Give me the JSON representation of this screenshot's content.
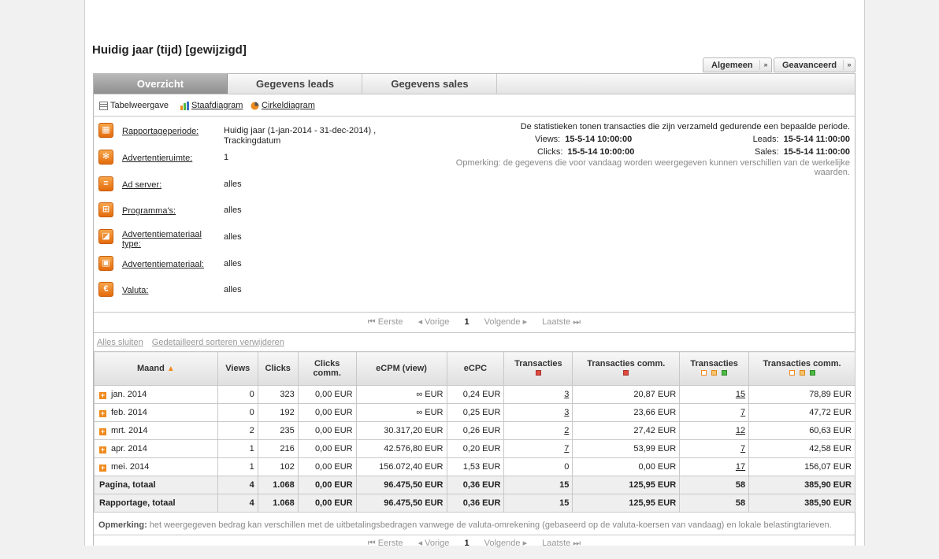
{
  "page": {
    "title": "Huidig jaar (tijd) [gewijzigd]"
  },
  "top_buttons": [
    {
      "label": "Algemeen"
    },
    {
      "label": "Geavanceerd"
    }
  ],
  "tabs": [
    {
      "label": "Overzicht"
    },
    {
      "label": "Gegevens leads"
    },
    {
      "label": "Gegevens sales"
    }
  ],
  "views": [
    {
      "label": "Tabelweergave",
      "icon": "table-icon"
    },
    {
      "label": "Staafdiagram",
      "icon": "bar-chart-icon"
    },
    {
      "label": "Cirkeldiagram",
      "icon": "pie-chart-icon"
    }
  ],
  "filters": [
    {
      "label": "Rapportageperiode:",
      "value": "Huidig jaar (1-jan-2014 - 31-dec-2014) , Trackingdatum",
      "icon": "calendar-icon"
    },
    {
      "label": "Advertentieruimte:",
      "value": "1",
      "icon": "network-icon"
    },
    {
      "label": "Ad server:",
      "value": "alles",
      "icon": "server-icon"
    },
    {
      "label": "Programma's:",
      "value": "alles",
      "icon": "grid-icon"
    },
    {
      "label": "Advertentiemateriaal type:",
      "value": "alles",
      "icon": "material-type-icon"
    },
    {
      "label": "Advertentiemateriaal:",
      "value": "alles",
      "icon": "image-icon"
    },
    {
      "label": "Valuta:",
      "value": "alles",
      "icon": "euro-icon"
    }
  ],
  "stats": {
    "note": "De statistieken tonen transacties die zijn verzameld gedurende een bepaalde periode.",
    "views_label": "Views:",
    "views_value": "15-5-14 10:00:00",
    "clicks_label": "Clicks:",
    "clicks_value": "15-5-14 10:00:00",
    "leads_label": "Leads:",
    "leads_value": "15-5-14 11:00:00",
    "sales_label": "Sales:",
    "sales_value": "15-5-14 11:00:00",
    "remark": "Opmerking: de gegevens die voor vandaag worden weergegeven kunnen verschillen van de werkelijke waarden."
  },
  "pager": {
    "first": "Eerste",
    "prev": "Vorige",
    "current": "1",
    "next": "Volgende",
    "last": "Laatste"
  },
  "table_links": {
    "collapse": "Alles sluiten",
    "reset_sort": "Gedetailleerd sorteren verwijderen"
  },
  "table": {
    "headers": [
      "Maand",
      "Views",
      "Clicks",
      "Clicks comm.",
      "eCPM (view)",
      "eCPC",
      "Transacties",
      "Transacties comm.",
      "Transacties",
      "Transacties comm."
    ],
    "rows": [
      {
        "maand": "jan. 2014",
        "views": "0",
        "clicks": "323",
        "clicks_comm": "0,00 EUR",
        "ecpm": "∞ EUR",
        "ecpc": "0,24 EUR",
        "trans1": "3",
        "trans_comm1": "20,87 EUR",
        "trans2": "15",
        "trans_comm2": "78,89 EUR"
      },
      {
        "maand": "feb. 2014",
        "views": "0",
        "clicks": "192",
        "clicks_comm": "0,00 EUR",
        "ecpm": "∞ EUR",
        "ecpc": "0,25 EUR",
        "trans1": "3",
        "trans_comm1": "23,66 EUR",
        "trans2": "7",
        "trans_comm2": "47,72 EUR"
      },
      {
        "maand": "mrt. 2014",
        "views": "2",
        "clicks": "235",
        "clicks_comm": "0,00 EUR",
        "ecpm": "30.317,20 EUR",
        "ecpc": "0,26 EUR",
        "trans1": "2",
        "trans_comm1": "27,42 EUR",
        "trans2": "12",
        "trans_comm2": "60,63 EUR"
      },
      {
        "maand": "apr. 2014",
        "views": "1",
        "clicks": "216",
        "clicks_comm": "0,00 EUR",
        "ecpm": "42.576,80 EUR",
        "ecpc": "0,20 EUR",
        "trans1": "7",
        "trans_comm1": "53,99 EUR",
        "trans2": "7",
        "trans_comm2": "42,58 EUR"
      },
      {
        "maand": "mei. 2014",
        "views": "1",
        "clicks": "102",
        "clicks_comm": "0,00 EUR",
        "ecpm": "156.072,40 EUR",
        "ecpc": "1,53 EUR",
        "trans1": "0",
        "trans_comm1": "0,00 EUR",
        "trans2": "17",
        "trans_comm2": "156,07 EUR"
      }
    ],
    "totals": [
      {
        "maand": "Pagina, totaal",
        "views": "4",
        "clicks": "1.068",
        "clicks_comm": "0,00 EUR",
        "ecpm": "96.475,50 EUR",
        "ecpc": "0,36 EUR",
        "trans1": "15",
        "trans_comm1": "125,95 EUR",
        "trans2": "58",
        "trans_comm2": "385,90 EUR"
      },
      {
        "maand": "Rapportage, totaal",
        "views": "4",
        "clicks": "1.068",
        "clicks_comm": "0,00 EUR",
        "ecpm": "96.475,50 EUR",
        "ecpc": "0,36 EUR",
        "trans1": "15",
        "trans_comm1": "125,95 EUR",
        "trans2": "58",
        "trans_comm2": "385,90 EUR"
      }
    ]
  },
  "bottom_remark": {
    "label": "Opmerking:",
    "text": "het weergegeven bedrag kan verschillen met de uitbetalingsbedragen vanwege de valuta-omrekening (gebaseerd op de valuta-koersen van vandaag) en lokale belastingtarieven."
  },
  "colors": {
    "accent": "#f08a1c",
    "tab_active": "#9a9a9a",
    "red": "#e04a3a",
    "green": "#4fb844"
  }
}
